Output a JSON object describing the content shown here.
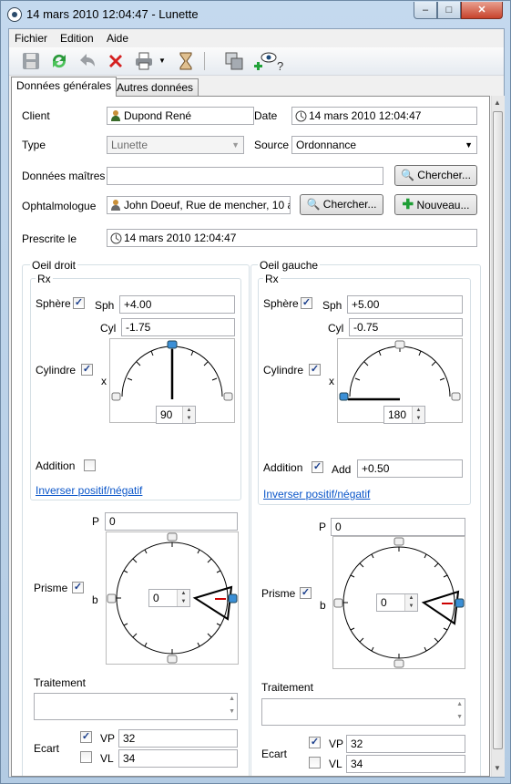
{
  "window": {
    "title": "14 mars 2010 12:04:47 - Lunette",
    "min": "–",
    "max": "□",
    "close": "✕"
  },
  "menu": [
    {
      "label": "Fichier"
    },
    {
      "label": "Edition"
    },
    {
      "label": "Aide"
    }
  ],
  "toolbar": {
    "icons": [
      "save-icon",
      "refresh-icon",
      "undo-icon",
      "delete-icon",
      "print-icon",
      "hourglass-icon",
      "duplicate-icon",
      "add-eye-help-icon"
    ]
  },
  "tabs": [
    {
      "label": "Données générales",
      "active": true
    },
    {
      "label": "Autres données",
      "active": false
    }
  ],
  "form": {
    "client_label": "Client",
    "client_value": "Dupond René",
    "date_label": "Date",
    "date_value": "14 mars 2010 12:04:47",
    "type_label": "Type",
    "type_value": "Lunette",
    "source_label": "Source",
    "source_value": "Ordonnance",
    "master_label": "Données maîtres",
    "master_value": "",
    "search_label": "Chercher...",
    "ophtal_label": "Ophtalmologue",
    "ophtal_value": "John Doeuf, Rue de mencher, 10 à",
    "new_label": "Nouveau...",
    "prescribed_label": "Prescrite le",
    "prescribed_value": "14 mars 2010 12:04:47"
  },
  "right_eye": {
    "title": "Oeil droit",
    "rx_title": "Rx",
    "sphere_label": "Sphère",
    "sphere_checked": true,
    "sph_label": "Sph",
    "sph_value": "+4.00",
    "cyl_label": "Cyl",
    "cyl_value": "-1.75",
    "cylinder_label": "Cylindre",
    "cylinder_checked": true,
    "axis_label": "x",
    "axis_value": "90",
    "addition_label": "Addition",
    "addition_checked": false,
    "invert_label": "Inverser positif/négatif",
    "p_label": "P",
    "p_value": "0",
    "prism_label": "Prisme",
    "prism_checked": true,
    "b_label": "b",
    "b_value": "0",
    "treatment_label": "Traitement",
    "ecart_label": "Ecart",
    "vp_label": "VP",
    "vp_checked": true,
    "vp_value": "32",
    "vl_label": "VL",
    "vl_checked": false,
    "vl_value": "34"
  },
  "left_eye": {
    "title": "Oeil gauche",
    "rx_title": "Rx",
    "sphere_label": "Sphère",
    "sphere_checked": true,
    "sph_label": "Sph",
    "sph_value": "+5.00",
    "cyl_label": "Cyl",
    "cyl_value": "-0.75",
    "cylinder_label": "Cylindre",
    "cylinder_checked": true,
    "axis_label": "x",
    "axis_value": "180",
    "addition_label": "Addition",
    "addition_checked": true,
    "add_label": "Add",
    "add_value": "+0.50",
    "invert_label": "Inverser positif/négatif",
    "p_label": "P",
    "p_value": "0",
    "prism_label": "Prisme",
    "prism_checked": true,
    "b_label": "b",
    "b_value": "0",
    "treatment_label": "Traitement",
    "ecart_label": "Ecart",
    "vp_label": "VP",
    "vp_checked": true,
    "vp_value": "32",
    "vl_label": "VL",
    "vl_checked": false,
    "vl_value": "34"
  },
  "colors": {
    "link": "#0b56c9",
    "prism_red": "#cc0000",
    "handle_blue": "#3b8fd6"
  }
}
